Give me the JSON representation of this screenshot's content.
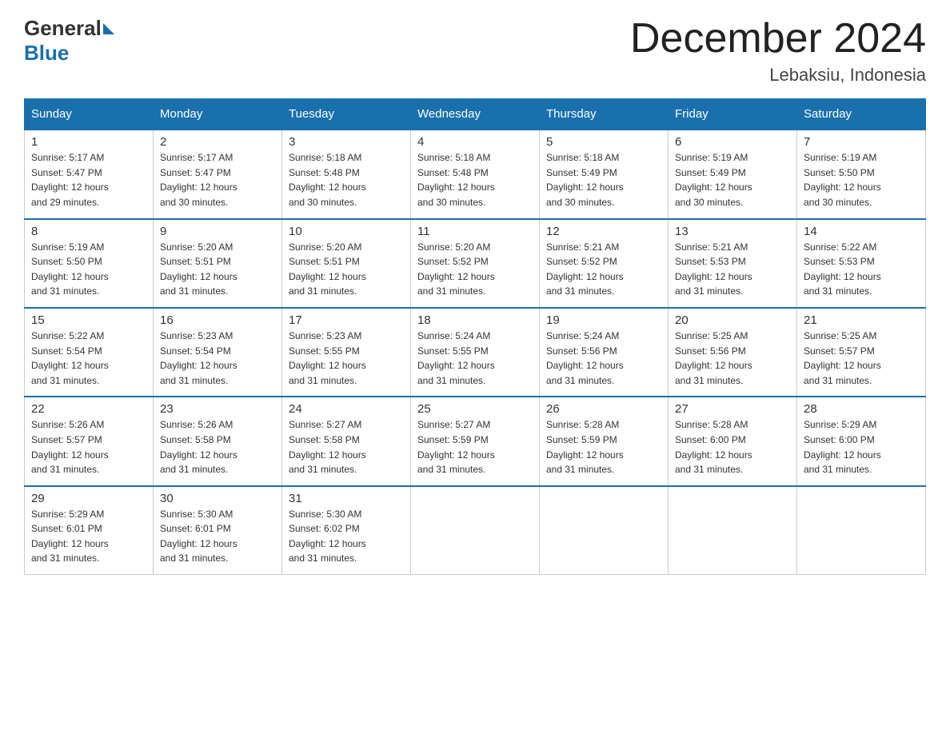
{
  "header": {
    "logo_general": "General",
    "logo_blue": "Blue",
    "month_title": "December 2024",
    "location": "Lebaksiu, Indonesia"
  },
  "weekdays": [
    "Sunday",
    "Monday",
    "Tuesday",
    "Wednesday",
    "Thursday",
    "Friday",
    "Saturday"
  ],
  "weeks": [
    [
      {
        "day": "1",
        "sunrise": "5:17 AM",
        "sunset": "5:47 PM",
        "daylight": "12 hours and 29 minutes."
      },
      {
        "day": "2",
        "sunrise": "5:17 AM",
        "sunset": "5:47 PM",
        "daylight": "12 hours and 30 minutes."
      },
      {
        "day": "3",
        "sunrise": "5:18 AM",
        "sunset": "5:48 PM",
        "daylight": "12 hours and 30 minutes."
      },
      {
        "day": "4",
        "sunrise": "5:18 AM",
        "sunset": "5:48 PM",
        "daylight": "12 hours and 30 minutes."
      },
      {
        "day": "5",
        "sunrise": "5:18 AM",
        "sunset": "5:49 PM",
        "daylight": "12 hours and 30 minutes."
      },
      {
        "day": "6",
        "sunrise": "5:19 AM",
        "sunset": "5:49 PM",
        "daylight": "12 hours and 30 minutes."
      },
      {
        "day": "7",
        "sunrise": "5:19 AM",
        "sunset": "5:50 PM",
        "daylight": "12 hours and 30 minutes."
      }
    ],
    [
      {
        "day": "8",
        "sunrise": "5:19 AM",
        "sunset": "5:50 PM",
        "daylight": "12 hours and 31 minutes."
      },
      {
        "day": "9",
        "sunrise": "5:20 AM",
        "sunset": "5:51 PM",
        "daylight": "12 hours and 31 minutes."
      },
      {
        "day": "10",
        "sunrise": "5:20 AM",
        "sunset": "5:51 PM",
        "daylight": "12 hours and 31 minutes."
      },
      {
        "day": "11",
        "sunrise": "5:20 AM",
        "sunset": "5:52 PM",
        "daylight": "12 hours and 31 minutes."
      },
      {
        "day": "12",
        "sunrise": "5:21 AM",
        "sunset": "5:52 PM",
        "daylight": "12 hours and 31 minutes."
      },
      {
        "day": "13",
        "sunrise": "5:21 AM",
        "sunset": "5:53 PM",
        "daylight": "12 hours and 31 minutes."
      },
      {
        "day": "14",
        "sunrise": "5:22 AM",
        "sunset": "5:53 PM",
        "daylight": "12 hours and 31 minutes."
      }
    ],
    [
      {
        "day": "15",
        "sunrise": "5:22 AM",
        "sunset": "5:54 PM",
        "daylight": "12 hours and 31 minutes."
      },
      {
        "day": "16",
        "sunrise": "5:23 AM",
        "sunset": "5:54 PM",
        "daylight": "12 hours and 31 minutes."
      },
      {
        "day": "17",
        "sunrise": "5:23 AM",
        "sunset": "5:55 PM",
        "daylight": "12 hours and 31 minutes."
      },
      {
        "day": "18",
        "sunrise": "5:24 AM",
        "sunset": "5:55 PM",
        "daylight": "12 hours and 31 minutes."
      },
      {
        "day": "19",
        "sunrise": "5:24 AM",
        "sunset": "5:56 PM",
        "daylight": "12 hours and 31 minutes."
      },
      {
        "day": "20",
        "sunrise": "5:25 AM",
        "sunset": "5:56 PM",
        "daylight": "12 hours and 31 minutes."
      },
      {
        "day": "21",
        "sunrise": "5:25 AM",
        "sunset": "5:57 PM",
        "daylight": "12 hours and 31 minutes."
      }
    ],
    [
      {
        "day": "22",
        "sunrise": "5:26 AM",
        "sunset": "5:57 PM",
        "daylight": "12 hours and 31 minutes."
      },
      {
        "day": "23",
        "sunrise": "5:26 AM",
        "sunset": "5:58 PM",
        "daylight": "12 hours and 31 minutes."
      },
      {
        "day": "24",
        "sunrise": "5:27 AM",
        "sunset": "5:58 PM",
        "daylight": "12 hours and 31 minutes."
      },
      {
        "day": "25",
        "sunrise": "5:27 AM",
        "sunset": "5:59 PM",
        "daylight": "12 hours and 31 minutes."
      },
      {
        "day": "26",
        "sunrise": "5:28 AM",
        "sunset": "5:59 PM",
        "daylight": "12 hours and 31 minutes."
      },
      {
        "day": "27",
        "sunrise": "5:28 AM",
        "sunset": "6:00 PM",
        "daylight": "12 hours and 31 minutes."
      },
      {
        "day": "28",
        "sunrise": "5:29 AM",
        "sunset": "6:00 PM",
        "daylight": "12 hours and 31 minutes."
      }
    ],
    [
      {
        "day": "29",
        "sunrise": "5:29 AM",
        "sunset": "6:01 PM",
        "daylight": "12 hours and 31 minutes."
      },
      {
        "day": "30",
        "sunrise": "5:30 AM",
        "sunset": "6:01 PM",
        "daylight": "12 hours and 31 minutes."
      },
      {
        "day": "31",
        "sunrise": "5:30 AM",
        "sunset": "6:02 PM",
        "daylight": "12 hours and 31 minutes."
      },
      null,
      null,
      null,
      null
    ]
  ],
  "labels": {
    "sunrise": "Sunrise:",
    "sunset": "Sunset:",
    "daylight": "Daylight:"
  }
}
